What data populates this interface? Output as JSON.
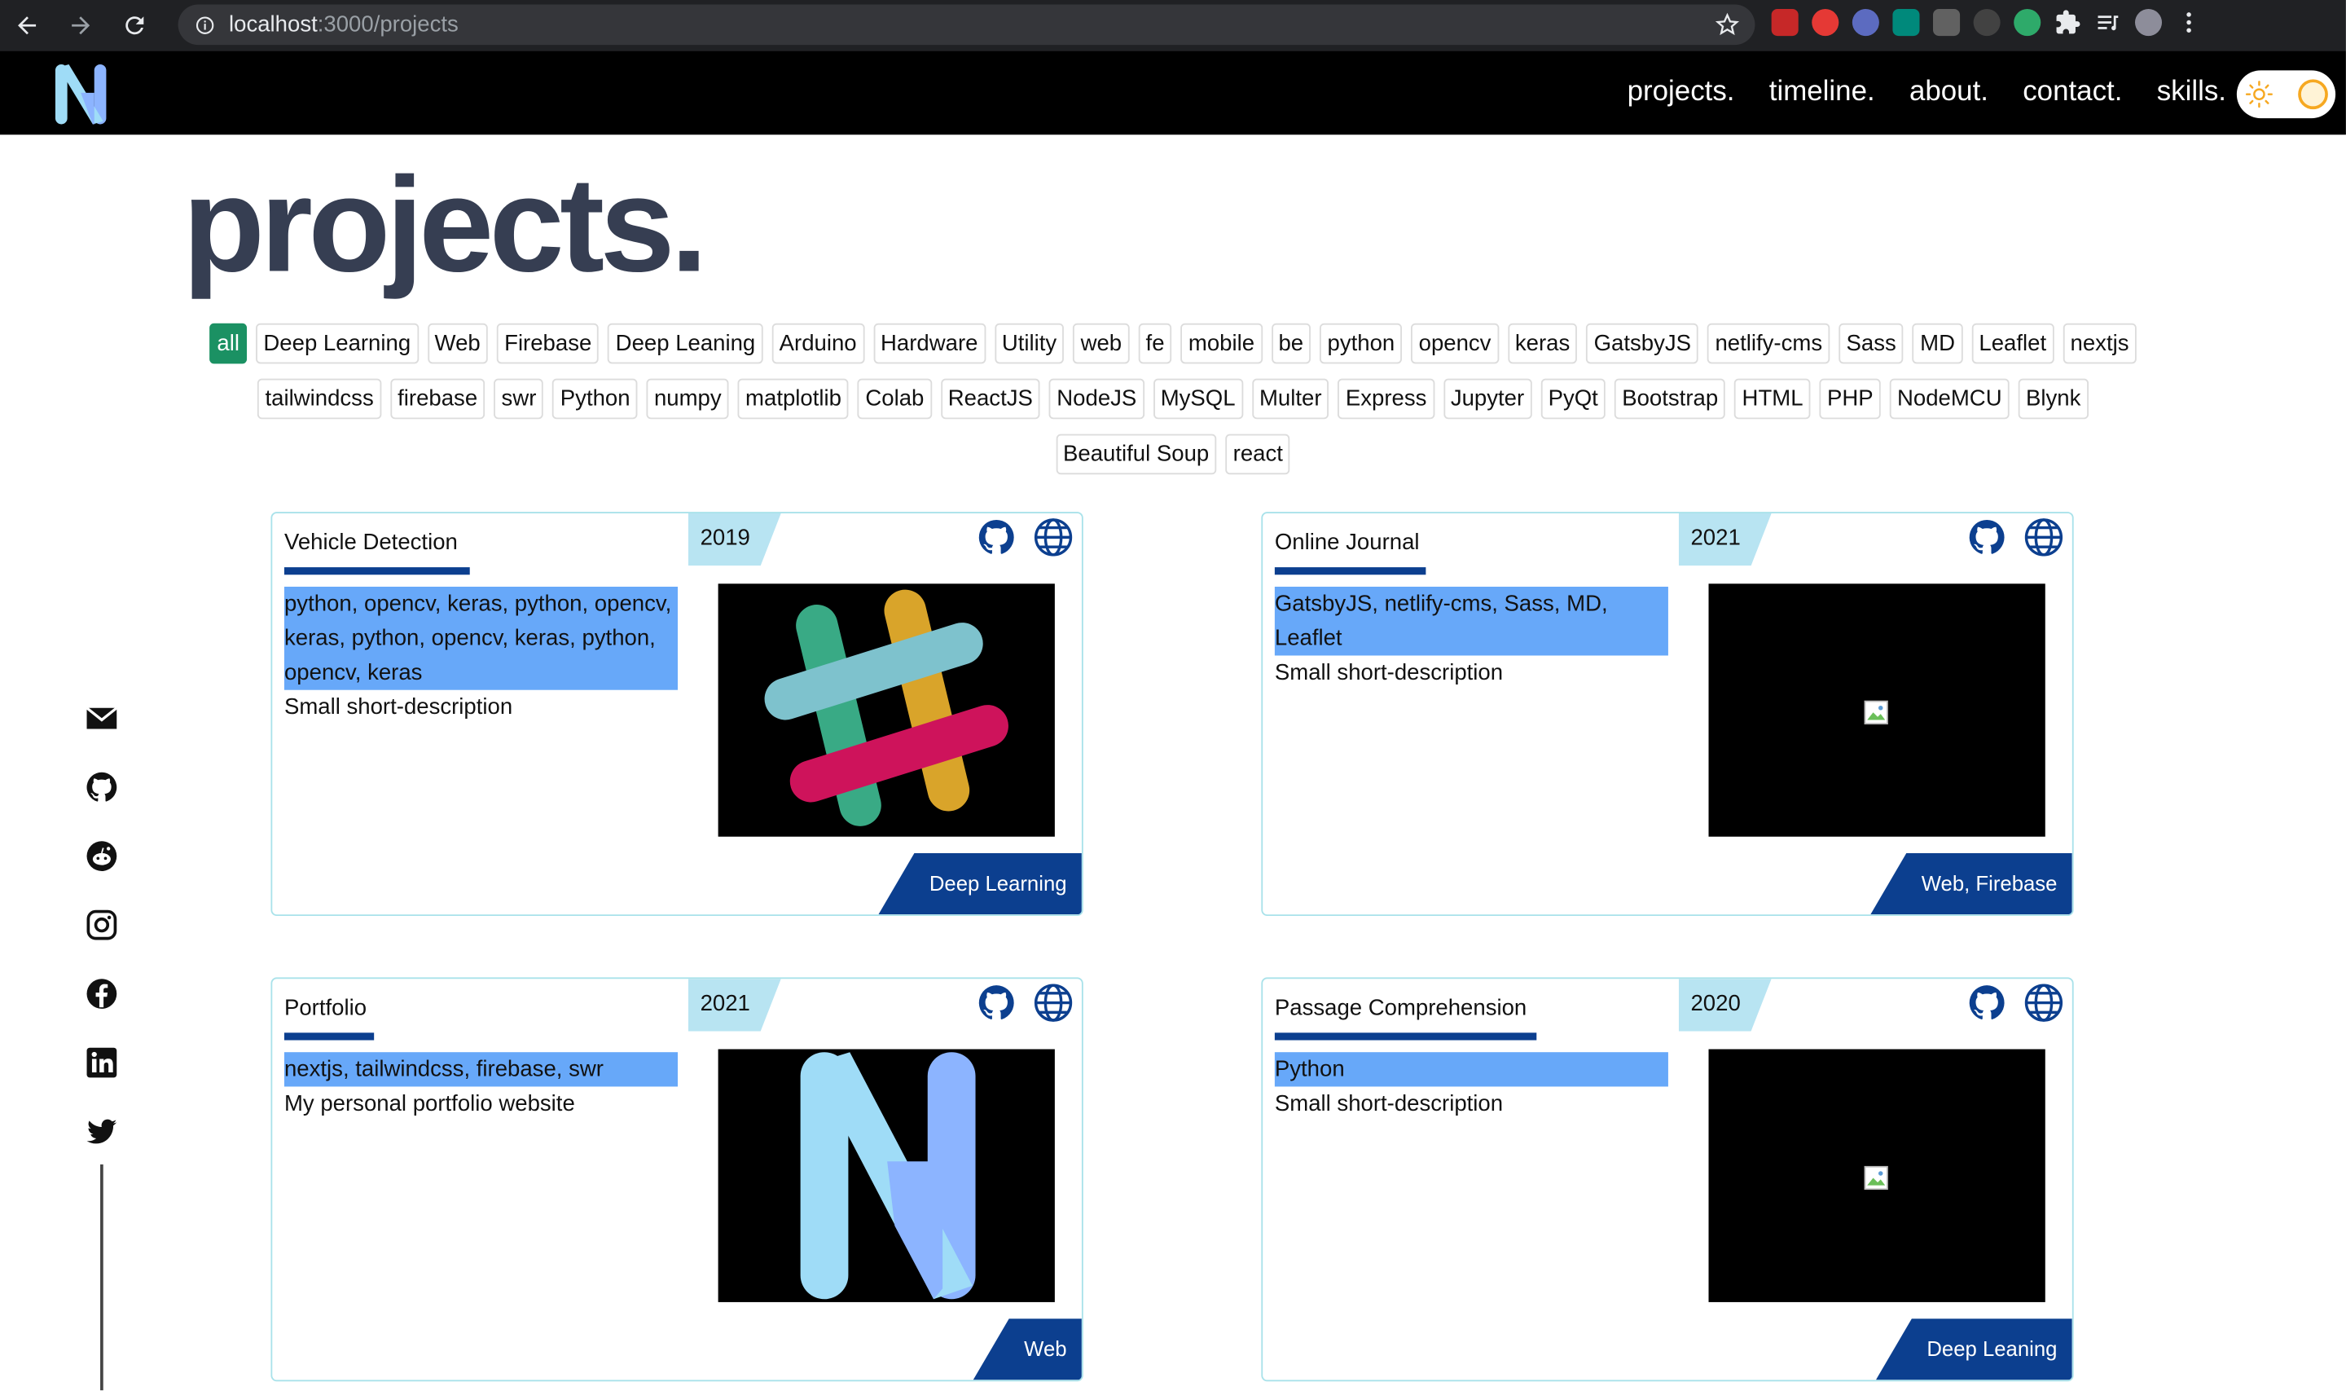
{
  "browser": {
    "url_host": "localhost",
    "url_rest": ":3000/projects"
  },
  "site": {
    "logo_letter": "N",
    "nav": [
      "projects.",
      "timeline.",
      "about.",
      "contact.",
      "skills."
    ]
  },
  "page": {
    "title": "projects."
  },
  "filters": {
    "active": "all",
    "tags": [
      "all",
      "Deep Learning",
      "Web",
      "Firebase",
      "Deep Leaning",
      "Arduino",
      "Hardware",
      "Utility",
      "web",
      "fe",
      "mobile",
      "be",
      "python",
      "opencv",
      "keras",
      "GatsbyJS",
      "netlify-cms",
      "Sass",
      "MD",
      "Leaflet",
      "nextjs",
      "tailwindcss",
      "firebase",
      "swr",
      "Python",
      "numpy",
      "matplotlib",
      "Colab",
      "ReactJS",
      "NodeJS",
      "MySQL",
      "Multer",
      "Express",
      "Jupyter",
      "PyQt",
      "Bootstrap",
      "HTML",
      "PHP",
      "NodeMCU",
      "Blynk",
      "Beautiful Soup",
      "react"
    ]
  },
  "social": [
    "mail-icon",
    "github-icon",
    "reddit-icon",
    "instagram-icon",
    "facebook-icon",
    "linkedin-icon",
    "twitter-icon"
  ],
  "colors": {
    "accent_green": "#1b9163",
    "card_blue": "#0c3f8f",
    "tag_highlight": "#67a8f9",
    "year_bg": "#b8e4f2",
    "header_bg": "#000000",
    "title_color": "#363e52"
  },
  "cards": [
    {
      "title": "Vehicle Detection",
      "year": "2019",
      "tags": "python, opencv, keras, python, opencv, keras, python, opencv, keras, python, opencv, keras",
      "desc": "Small short-description",
      "category": "Deep Learning",
      "thumb": "slack-logo"
    },
    {
      "title": "Online Journal",
      "year": "2021",
      "tags": "GatsbyJS, netlify-cms, Sass, MD, Leaflet",
      "desc": "Small short-description",
      "category": "Web, Firebase",
      "thumb": "broken-image"
    },
    {
      "title": "Portfolio",
      "year": "2021",
      "tags": "nextjs, tailwindcss, firebase, swr",
      "desc": "My personal portfolio website",
      "category": "Web",
      "thumb": "n-logo"
    },
    {
      "title": "Passage Comprehension",
      "year": "2020",
      "tags": "Python",
      "desc": "Small short-description",
      "category": "Deep Leaning",
      "thumb": "broken-image"
    }
  ]
}
